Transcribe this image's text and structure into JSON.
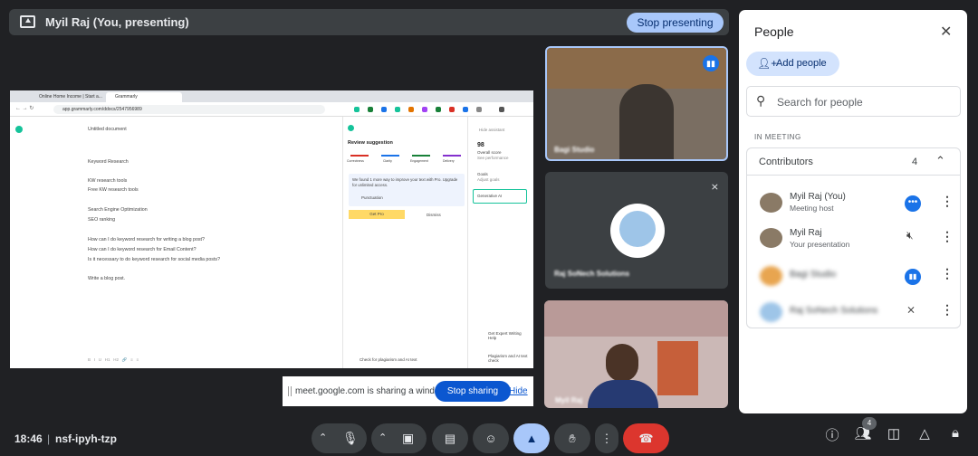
{
  "presenting_bar": {
    "title": "Myil Raj (You, presenting)",
    "stop_label": "Stop presenting"
  },
  "shared_screen": {
    "tabs": [
      "Online Home Income | Start a...",
      "Grammarly"
    ],
    "url": "app.grammarly.com/ddocs/2547956989",
    "doc_title": "Untitled document",
    "doc_lines": [
      "Keyword Research",
      "KW research tools",
      "Free KW research tools",
      "Search Engine Optimization",
      "SEO ranking",
      "How can I do keyword research for writing a blog post?",
      "How can I do keyword research for Email Content?",
      "Is it necessary to do keyword research for social media posts?",
      "Write a blog post."
    ],
    "review_title": "Review suggestion",
    "hide_assistant": "Hide assistant",
    "categories": [
      "Correctness",
      "Clarity",
      "Engagement",
      "Delivery"
    ],
    "promo_text": "We found 1 more way to improve your text with Pro. Upgrade for unlimited access.",
    "promo_item": "Punctuation",
    "get_pro": "Get Pro",
    "dismiss": "Dismiss",
    "score": "98",
    "score_label": "Overall score",
    "score_sub": "See performance",
    "goals": "Goals",
    "goals_sub": "Adjust goals",
    "genai": "Generative AI",
    "expert": "Get Expert Writing Help",
    "plagiarism": "Plagiarism and AI text check",
    "check_link": "Check for plagiarism and AI text"
  },
  "share_notice": {
    "text": "meet.google.com is sharing a window.",
    "stop": "Stop sharing",
    "hide": "Hide"
  },
  "tiles": {
    "t1_name": "Bagi Studio",
    "t2_name": "Raj SoNech Solutions",
    "t3_name": "Myil Raj"
  },
  "people": {
    "title": "People",
    "add_label": "Add people",
    "search_placeholder": "Search for people",
    "in_meeting": "IN MEETING",
    "group_label": "Contributors",
    "group_count": "4",
    "members": [
      {
        "name": "Myil Raj (You)",
        "sub": "Meeting host"
      },
      {
        "name": "Myil Raj",
        "sub": "Your presentation"
      },
      {
        "name": "Bagi Studio",
        "sub": ""
      },
      {
        "name": "Raj SoNech Solutions",
        "sub": ""
      }
    ]
  },
  "bottom": {
    "time": "18:46",
    "meeting_code": "nsf-ipyh-tzp",
    "people_badge": "4"
  },
  "colors": {
    "accent": "#a8c7fa",
    "hangup": "#dc362e",
    "background": "#202124"
  }
}
